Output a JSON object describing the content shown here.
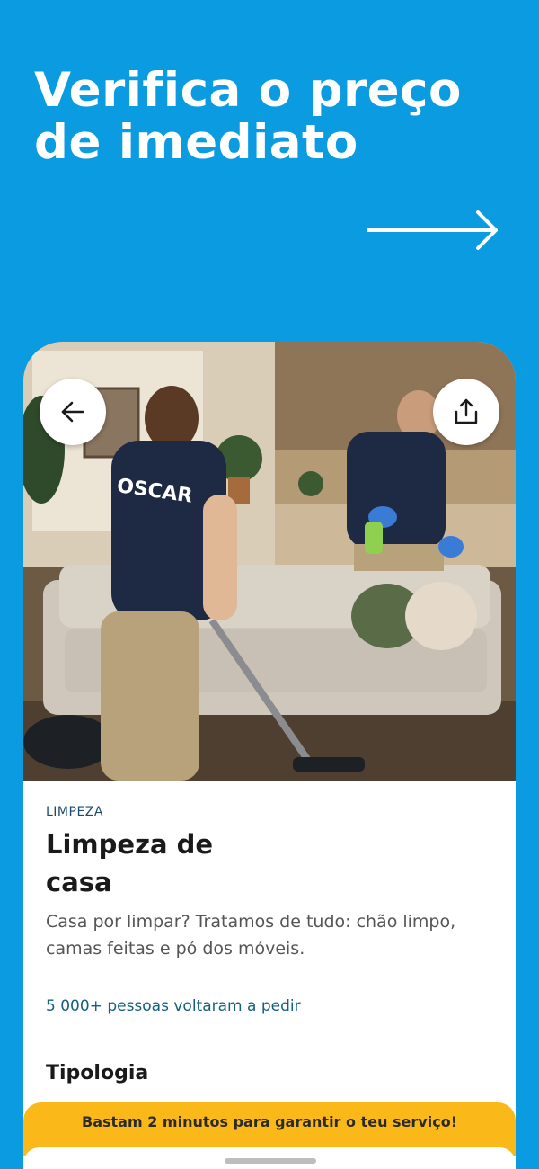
{
  "hero": {
    "headline_line1": "Verifica o preço",
    "headline_line2": "de imediato",
    "arrow_icon": "arrow-right-icon"
  },
  "service": {
    "photo_shirt_text": "OSCAR",
    "category": "LIMPEZA",
    "title": "Limpeza de casa",
    "description": "Casa por limpar? Tratamos de tudo: chão limpo, camas feitas e pó dos móveis.",
    "social_proof": "5 000+ pessoas voltaram a pedir",
    "section_title": "Tipologia"
  },
  "buttons": {
    "back_icon": "arrow-left-icon",
    "share_icon": "share-icon"
  },
  "banner": {
    "text": "Bastam 2 minutos para garantir o teu serviço!"
  },
  "colors": {
    "background": "#0A9BE0",
    "banner": "#FBB919",
    "category_text": "#1E4A6B",
    "social_text": "#16607F"
  }
}
